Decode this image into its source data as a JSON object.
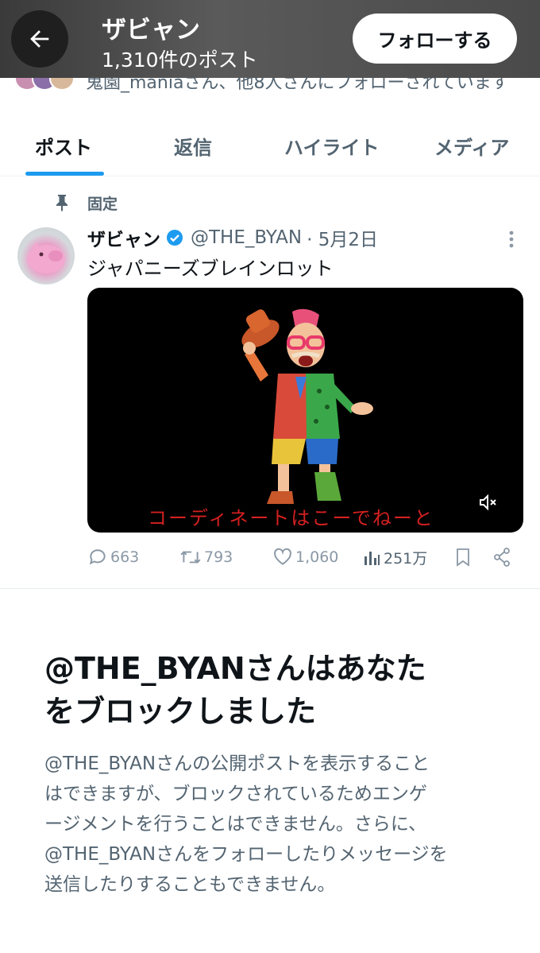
{
  "header": {
    "name": "ザビャン",
    "post_count": "1,310件のポスト",
    "follow_label": "フォローする"
  },
  "followed_by": "鬼園_maniaさん、他8人さんにフォローされています",
  "tabs": [
    {
      "label": "ポスト",
      "active": true
    },
    {
      "label": "返信",
      "active": false
    },
    {
      "label": "ハイライト",
      "active": false
    },
    {
      "label": "メディア",
      "active": false
    }
  ],
  "pinned_label": "固定",
  "tweet": {
    "name": "ザビャン",
    "handle": "@THE_BYAN",
    "date": "· 5月2日",
    "text": "ジャパニーズブレインロット",
    "media_caption": "コーディネートはこーでねーと",
    "stats": {
      "replies": "663",
      "retweets": "793",
      "likes": "1,060",
      "views": "251万"
    }
  },
  "block": {
    "title_line1": "@THE_BYANさんはあなた",
    "title_line2": "をブロックしました",
    "desc_line1": "@THE_BYANさんの公開ポストを表示すること",
    "desc_line2": "はできますが、ブロックされているためエンゲ",
    "desc_line3": "ージメントを行うことはできません。さらに、",
    "desc_line4": "@THE_BYANさんをフォローしたりメッセージを",
    "desc_line5": "送信したりすることもできません。"
  },
  "colors": {
    "accent": "#1d9bf0",
    "caption_red": "#d42020",
    "muted": "#536471"
  },
  "icons": [
    "back-arrow-icon",
    "pin-icon",
    "verified-badge-icon",
    "more-icon",
    "mute-icon",
    "reply-icon",
    "retweet-icon",
    "like-icon",
    "views-icon",
    "bookmark-icon",
    "share-icon"
  ]
}
